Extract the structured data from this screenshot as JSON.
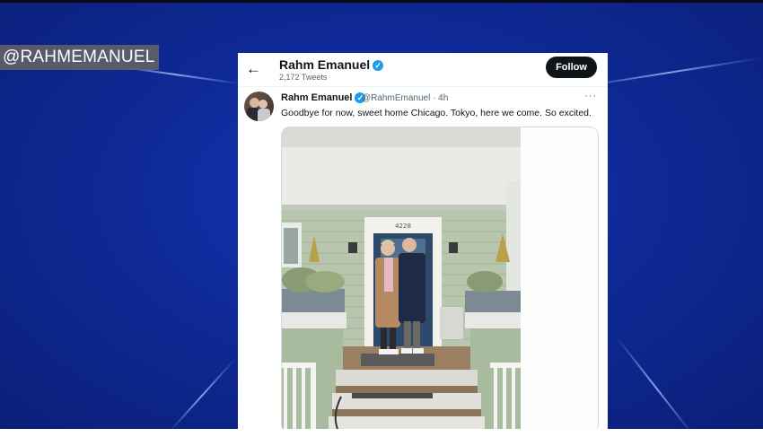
{
  "broadcast": {
    "handle_label": "@RAHMEMANUEL"
  },
  "profile_header": {
    "name": "Rahm Emanuel",
    "tweet_count": "2,172 Tweets",
    "follow_label": "Follow"
  },
  "tweet": {
    "author_name": "Rahm Emanuel",
    "author_handle": "@RahmEmanuel",
    "time": "· 4h",
    "text": "Goodbye for now, sweet home Chicago. Tokyo, here we come. So excited.",
    "more_label": "···",
    "house_number": "4228"
  },
  "icons": {
    "back": "arrow-left-icon",
    "verified": "verified-badge-icon",
    "more": "more-horizontal-icon"
  },
  "colors": {
    "background_blue": "#0f2a98",
    "verified_blue": "#1d9bf0",
    "follow_button": "#0f1419"
  }
}
